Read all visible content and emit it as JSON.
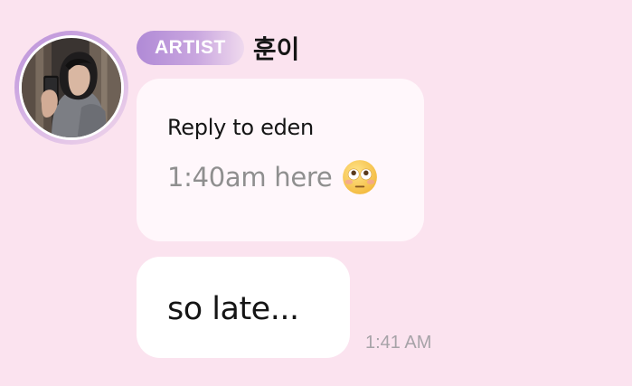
{
  "sender": {
    "badge": "ARTIST",
    "name": "훈이",
    "avatar": "profile-photo"
  },
  "reply": {
    "label": "Reply to eden",
    "quoted_text": "1:40am here",
    "quoted_emoji": "flushed-face-emoji"
  },
  "message": {
    "text": "so late...",
    "time": "1:41 AM"
  },
  "colors": {
    "background": "#fbe3ef",
    "badge_start": "#b08ad6",
    "badge_end": "#efd9ee",
    "bubble": "#ffffff",
    "quoted_text": "#8f8f8f",
    "time_text": "#a7a3a8"
  }
}
